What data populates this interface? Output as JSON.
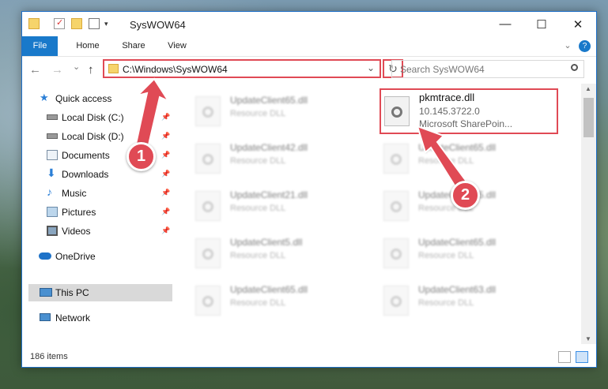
{
  "window": {
    "title": "SysWOW64",
    "minimize": "—",
    "maximize": "☐",
    "close": "✕"
  },
  "ribbon": {
    "tabs": [
      "File",
      "Home",
      "Share",
      "View"
    ],
    "help": "?"
  },
  "nav": {
    "back": "←",
    "forward": "→",
    "recent": "⌄",
    "up": "↑",
    "address": "C:\\Windows\\SysWOW64",
    "refresh": "↻",
    "search_placeholder": "Search SysWOW64"
  },
  "sidebar": {
    "items": [
      {
        "label": "Quick access",
        "icon": "star-icon",
        "pinned": false
      },
      {
        "label": "Local Disk (C:)",
        "icon": "drive-icon",
        "pinned": true
      },
      {
        "label": "Local Disk (D:)",
        "icon": "drive-icon",
        "pinned": true
      },
      {
        "label": "Documents",
        "icon": "documents-icon",
        "pinned": true
      },
      {
        "label": "Downloads",
        "icon": "downloads-icon",
        "pinned": true
      },
      {
        "label": "Music",
        "icon": "music-icon",
        "pinned": true
      },
      {
        "label": "Pictures",
        "icon": "pictures-icon",
        "pinned": true
      },
      {
        "label": "Videos",
        "icon": "videos-icon",
        "pinned": true
      },
      {
        "label": "OneDrive",
        "icon": "cloud-icon",
        "pinned": false
      },
      {
        "label": "This PC",
        "icon": "computer-icon",
        "pinned": false,
        "selected": true
      },
      {
        "label": "Network",
        "icon": "network-icon",
        "pinned": false
      }
    ]
  },
  "files": {
    "left_column": [
      {
        "name": "UpdateClient65.dll",
        "type": "Resource DLL"
      },
      {
        "name": "UpdateClient42.dll",
        "type": "Resource DLL"
      },
      {
        "name": "UpdateClient21.dll",
        "type": "Resource DLL"
      },
      {
        "name": "UpdateClient5.dll",
        "type": "Resource DLL"
      },
      {
        "name": "UpdateClient65.dll",
        "type": "Resource DLL"
      }
    ],
    "right_column": [
      {
        "name": "UpdateClient65.dll",
        "type": "Resource DLL"
      },
      {
        "name": "UpdateClient65.dll",
        "type": "Resource DLL"
      },
      {
        "name": "UpdateClient65.dll",
        "type": "Resource DLL"
      },
      {
        "name": "UpdateClient63.dll",
        "type": "Resource DLL"
      }
    ],
    "highlighted": {
      "name": "pkmtrace.dll",
      "version": "10.145.3722.0",
      "description": "Microsoft SharePoin..."
    }
  },
  "status": {
    "item_count": "186 items"
  },
  "annotations": {
    "step1": "1",
    "step2": "2",
    "color": "#e04a55"
  }
}
